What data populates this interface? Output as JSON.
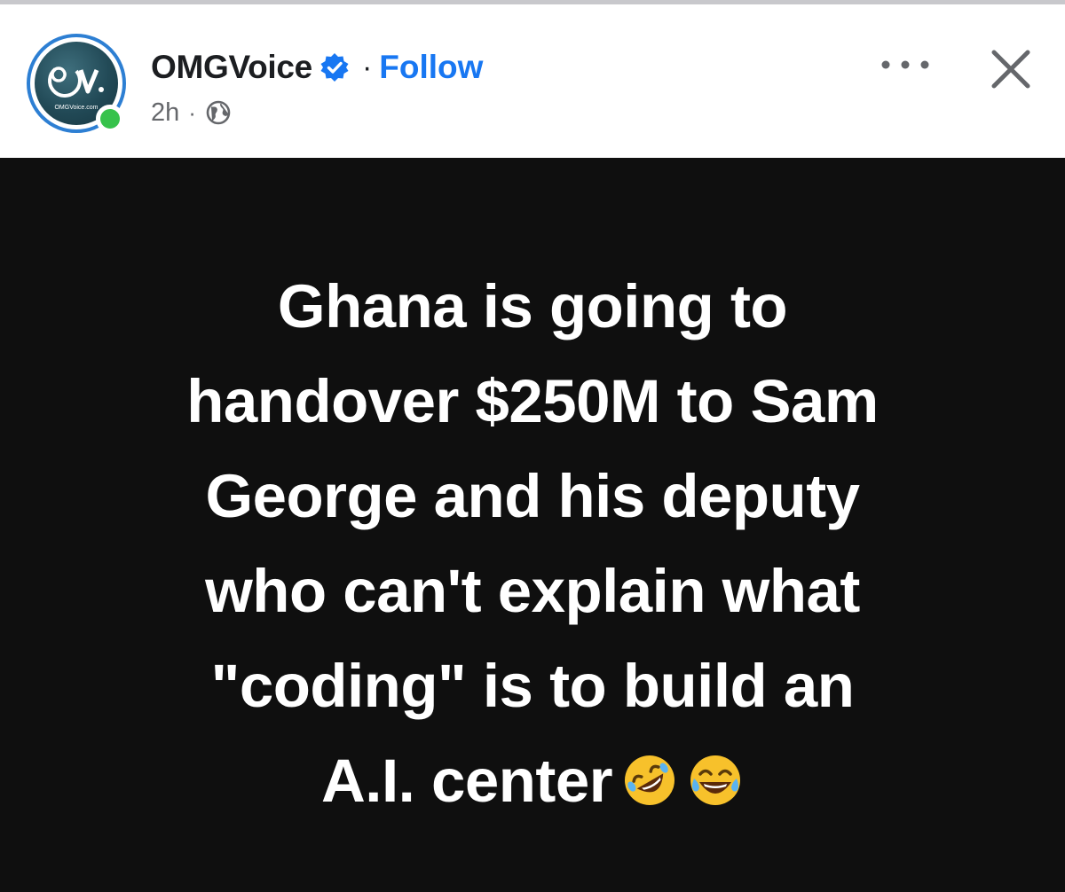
{
  "post": {
    "page_name": "OMGVoice",
    "follow_label": "Follow",
    "separator": "·",
    "timestamp": "2h",
    "audience_icon": "globe-icon",
    "avatar_text": "OMGVoice.com",
    "image_text_lines": [
      "Ghana is going to",
      "handover $250M to Sam",
      "George and his deputy",
      "who can't explain what",
      "\"coding\" is to build an",
      "A.I. center"
    ],
    "emojis": [
      "rolling-on-floor-laughing-emoji",
      "tears-of-joy-emoji"
    ]
  },
  "colors": {
    "follow": "#1877f2",
    "verified_badge": "#1877f2",
    "online": "#36c24b",
    "image_bg": "#0f0f0f",
    "avatar_ring": "#2d7fd3"
  }
}
